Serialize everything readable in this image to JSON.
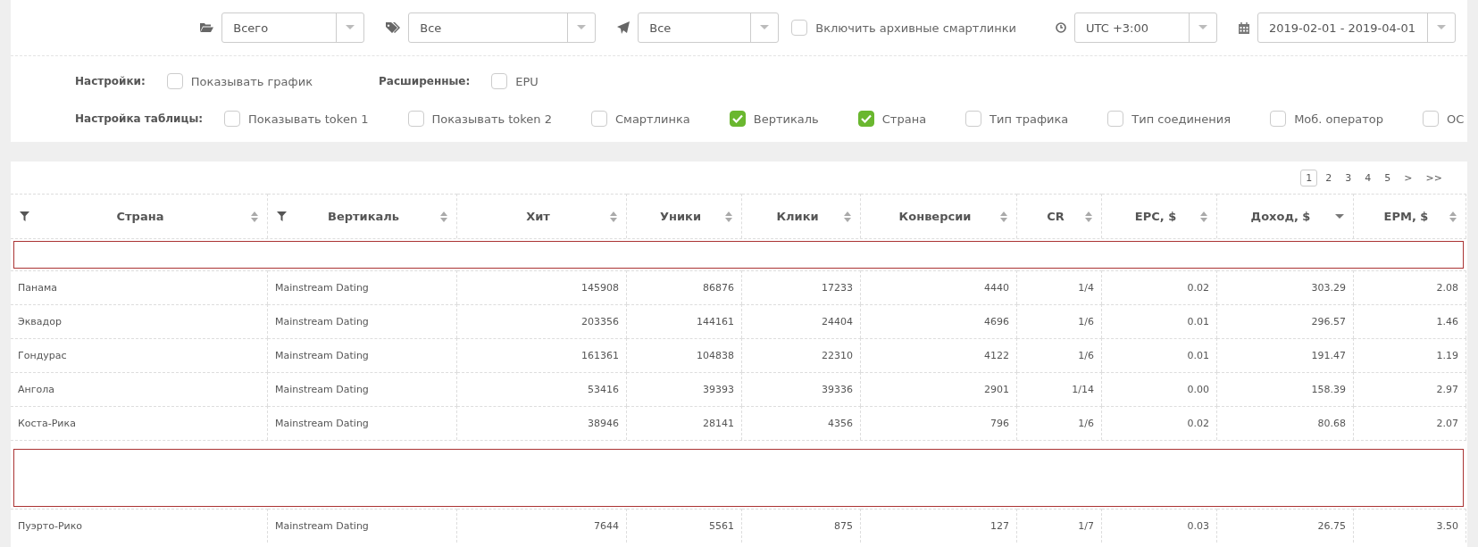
{
  "filters": [
    {
      "kind": "folder",
      "value": "Всего"
    },
    {
      "kind": "tag",
      "value": "Все"
    },
    {
      "kind": "plane",
      "value": "Все"
    }
  ],
  "archive_toggle": {
    "label": "Включить архивные смартлинки",
    "checked": false
  },
  "timezone": {
    "value": "UTC +3:00"
  },
  "date_range": {
    "value": "2019-02-01 - 2019-04-01"
  },
  "settings": {
    "label": "Настройки:",
    "options": [
      {
        "label": "Показывать график",
        "checked": false
      }
    ]
  },
  "extended": {
    "label": "Расширенные:",
    "options": [
      {
        "label": "EPU",
        "checked": false
      }
    ]
  },
  "table_settings": {
    "label": "Настройка таблицы:",
    "options": [
      {
        "label": "Показывать token 1",
        "checked": false
      },
      {
        "label": "Показывать token 2",
        "checked": false
      },
      {
        "label": "Смартлинка",
        "checked": false
      },
      {
        "label": "Вертикаль",
        "checked": true
      },
      {
        "label": "Страна",
        "checked": true
      },
      {
        "label": "Тип трафика",
        "checked": false
      },
      {
        "label": "Тип соединения",
        "checked": false
      },
      {
        "label": "Моб. оператор",
        "checked": false
      },
      {
        "label": "ОС",
        "checked": false
      }
    ]
  },
  "pagination": [
    {
      "label": "1",
      "selected": true
    },
    {
      "label": "2",
      "selected": false
    },
    {
      "label": "3",
      "selected": false
    },
    {
      "label": "4",
      "selected": false
    },
    {
      "label": "5",
      "selected": false
    },
    {
      "label": ">",
      "selected": false
    },
    {
      "label": ">>",
      "selected": false
    }
  ],
  "table": {
    "columns": [
      {
        "name": "Страна",
        "filter": true,
        "sorted_desc": false
      },
      {
        "name": "Вертикаль",
        "filter": true,
        "sorted_desc": false
      },
      {
        "name": "Хит",
        "filter": false,
        "sorted_desc": false
      },
      {
        "name": "Уники",
        "filter": false,
        "sorted_desc": false
      },
      {
        "name": "Клики",
        "filter": false,
        "sorted_desc": false
      },
      {
        "name": "Конверсии",
        "filter": false,
        "sorted_desc": false
      },
      {
        "name": "CR",
        "filter": false,
        "sorted_desc": false
      },
      {
        "name": "EPC, $",
        "filter": false,
        "sorted_desc": false
      },
      {
        "name": "Доход, $",
        "filter": false,
        "sorted_desc": true
      },
      {
        "name": "EPM, $",
        "filter": false,
        "sorted_desc": false
      }
    ],
    "rows": [
      {
        "kind": "mask"
      },
      {
        "kind": "data",
        "cells": [
          "Панама",
          "Mainstream Dating",
          "145908",
          "86876",
          "17233",
          "4440",
          "1/4",
          "0.02",
          "303.29",
          "2.08"
        ]
      },
      {
        "kind": "data",
        "cells": [
          "Эквадор",
          "Mainstream Dating",
          "203356",
          "144161",
          "24404",
          "4696",
          "1/6",
          "0.01",
          "296.57",
          "1.46"
        ]
      },
      {
        "kind": "data",
        "cells": [
          "Гондурас",
          "Mainstream Dating",
          "161361",
          "104838",
          "22310",
          "4122",
          "1/6",
          "0.01",
          "191.47",
          "1.19"
        ]
      },
      {
        "kind": "data",
        "cells": [
          "Ангола",
          "Mainstream Dating",
          "53416",
          "39393",
          "39336",
          "2901",
          "1/14",
          "0.00",
          "158.39",
          "2.97"
        ]
      },
      {
        "kind": "data",
        "cells": [
          "Коста-Рика",
          "Mainstream Dating",
          "38946",
          "28141",
          "4356",
          "796",
          "1/6",
          "0.02",
          "80.68",
          "2.07"
        ]
      },
      {
        "kind": "bigmask"
      },
      {
        "kind": "data",
        "cells": [
          "Пуэрто-Рико",
          "Mainstream Dating",
          "7644",
          "5561",
          "875",
          "127",
          "1/7",
          "0.03",
          "26.75",
          "3.50"
        ]
      }
    ]
  }
}
